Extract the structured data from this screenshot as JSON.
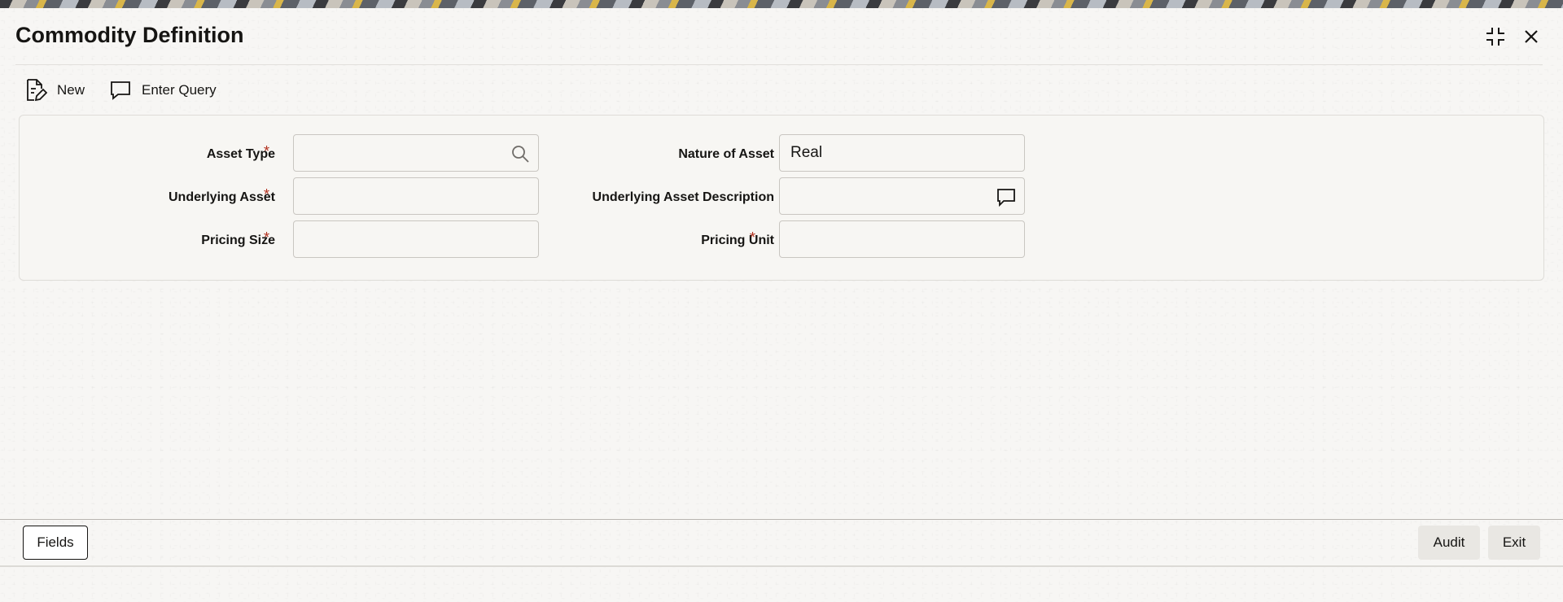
{
  "window": {
    "title": "Commodity Definition"
  },
  "toolbar": {
    "new_label": "New",
    "enter_query_label": "Enter Query"
  },
  "form": {
    "asset_type": {
      "label": "Asset Type",
      "required": "*",
      "value": ""
    },
    "underlying_asset": {
      "label": "Underlying Asset",
      "required": "*",
      "value": ""
    },
    "pricing_size": {
      "label": "Pricing Size",
      "required": "*",
      "value": ""
    },
    "nature_of_asset": {
      "label": "Nature of Asset",
      "value": "Real"
    },
    "underlying_asset_description": {
      "label": "Underlying Asset Description",
      "value": ""
    },
    "pricing_unit": {
      "label": "Pricing Unit",
      "required": "*",
      "value": ""
    }
  },
  "footer": {
    "fields_label": "Fields",
    "audit_label": "Audit",
    "exit_label": "Exit"
  },
  "colors": {
    "required_marker": "#b3311f",
    "background": "#f7f6f4"
  }
}
